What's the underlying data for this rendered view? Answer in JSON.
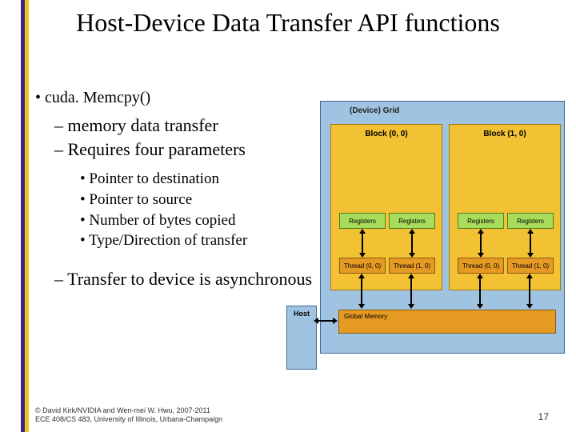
{
  "title": "Host-Device Data Transfer API functions",
  "bullets": {
    "fn": "cuda. Memcpy()",
    "sub1": "memory data transfer",
    "sub2": "Requires four parameters",
    "params": [
      "Pointer to destination",
      "Pointer to source",
      "Number of bytes copied",
      "Type/Direction of transfer"
    ],
    "sub3": "Transfer to device is asynchronous"
  },
  "diagram": {
    "gridLabel": "(Device) Grid",
    "blocks": [
      "Block (0, 0)",
      "Block (1, 0)"
    ],
    "registers": "Registers",
    "threads": [
      "Thread (0, 0)",
      "Thread (1, 0)"
    ],
    "globalMemory": "Global Memory",
    "host": "Host"
  },
  "footer": {
    "l1": "© David Kirk/NVIDIA and Wen-mei W. Hwu, 2007-2011",
    "l2": "ECE 408/CS 483, University of Illinois, Urbana-Champaign"
  },
  "page": "17"
}
